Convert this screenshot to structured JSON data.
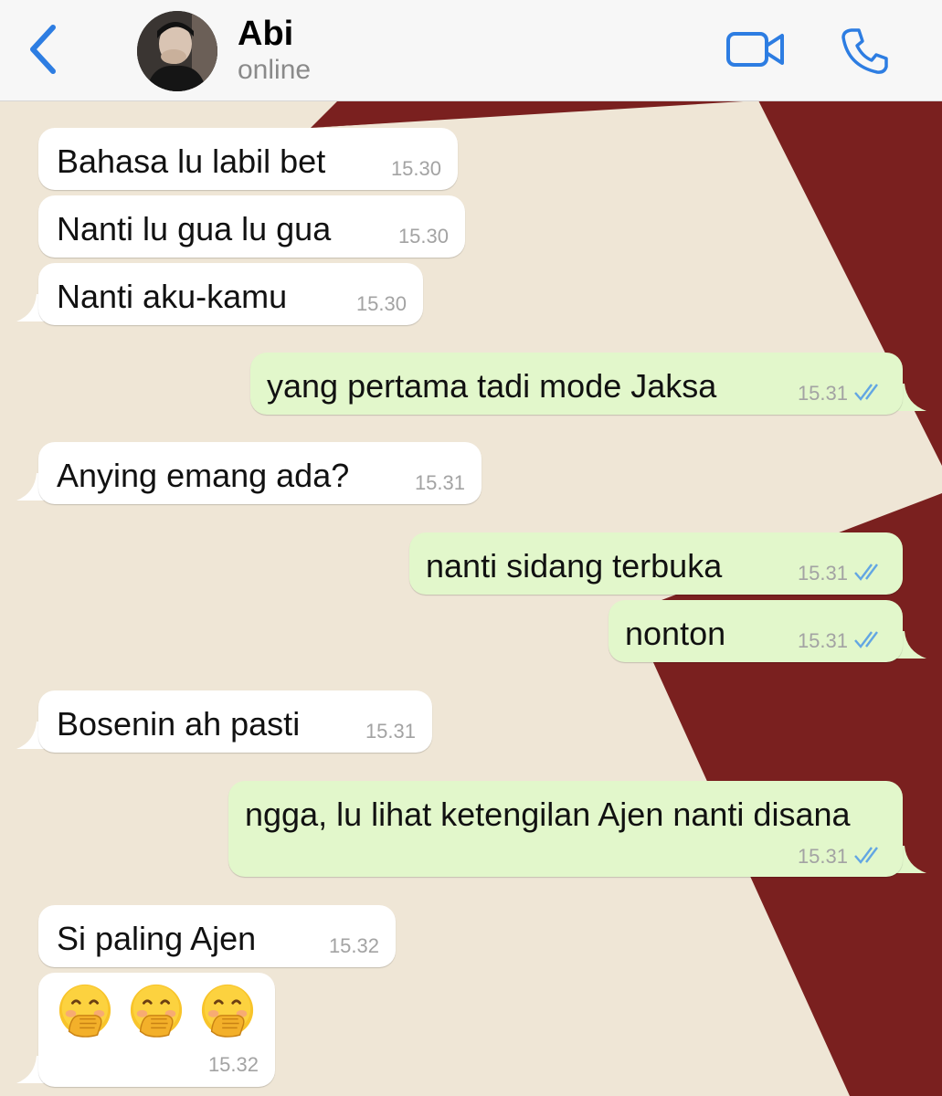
{
  "contact": {
    "name": "Abi",
    "status": "online"
  },
  "icons": {
    "back": "chevron-left-icon",
    "video": "video-camera-icon",
    "call": "phone-icon",
    "read": "double-check-icon",
    "emoji": "face-with-hand-over-mouth"
  },
  "colors": {
    "accent": "#2d7de2",
    "incoming": "#ffffff",
    "outgoing": "#e2f7cb",
    "wallpaper_light": "#efe6d6",
    "wallpaper_dark": "#7a201f"
  },
  "messages": [
    {
      "direction": "in",
      "text": "Bahasa lu labil bet",
      "time": "15.30"
    },
    {
      "direction": "in",
      "text": "Nanti lu gua lu gua",
      "time": "15.30"
    },
    {
      "direction": "in",
      "text": "Nanti aku-kamu",
      "time": "15.30"
    },
    {
      "direction": "out",
      "text": "yang pertama tadi mode Jaksa",
      "time": "15.31"
    },
    {
      "direction": "in",
      "text": "Anying emang ada?",
      "time": "15.31"
    },
    {
      "direction": "out",
      "text": "nanti sidang terbuka",
      "time": "15.31"
    },
    {
      "direction": "out",
      "text": "nonton",
      "time": "15.31"
    },
    {
      "direction": "in",
      "text": "Bosenin ah pasti",
      "time": "15.31"
    },
    {
      "direction": "out",
      "text": "ngga, lu lihat ketengilan Ajen nanti disana",
      "time": "15.31"
    },
    {
      "direction": "in",
      "text": "Si paling Ajen",
      "time": "15.32"
    },
    {
      "direction": "in",
      "text": "🤭 🤭 🤭",
      "time": "15.32"
    }
  ]
}
